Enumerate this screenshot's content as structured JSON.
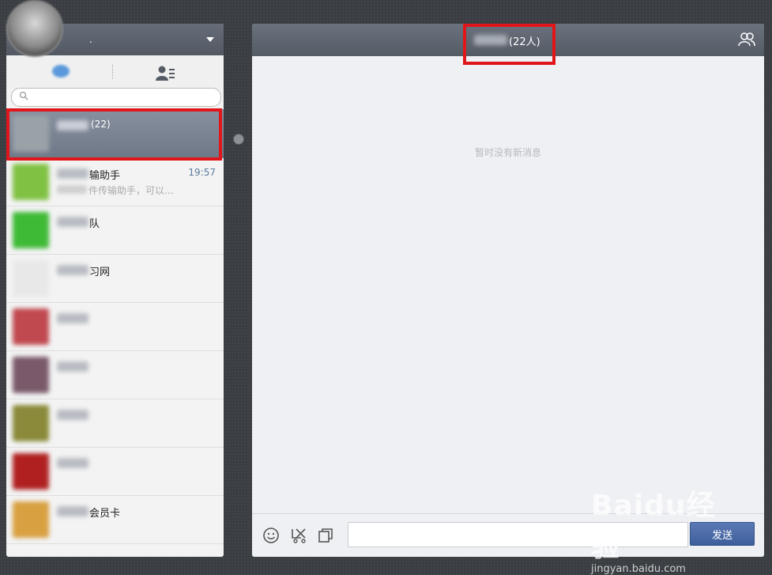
{
  "left_panel": {
    "user_name_tail": ".",
    "search_placeholder": "",
    "chats": [
      {
        "name_tail": "(22)",
        "preview_tail": "",
        "time": "",
        "avatar_color": "#9aa2a8",
        "selected": true
      },
      {
        "name_tail": "输助手",
        "preview_tail": "件传输助手，可以...",
        "time": "19:57",
        "avatar_color": "#7fc142",
        "selected": false
      },
      {
        "name_tail": "队",
        "preview_tail": "",
        "time": "",
        "avatar_color": "#3fba36",
        "selected": false
      },
      {
        "name_tail": "习网",
        "preview_tail": "",
        "time": "",
        "avatar_color": "#e8e8e8",
        "selected": false
      },
      {
        "name_tail": "",
        "preview_tail": "",
        "time": "",
        "avatar_color": "#c0484f",
        "selected": false
      },
      {
        "name_tail": "",
        "preview_tail": "",
        "time": "",
        "avatar_color": "#7a5a6a",
        "selected": false
      },
      {
        "name_tail": "",
        "preview_tail": "",
        "time": "",
        "avatar_color": "#8a8a3a",
        "selected": false
      },
      {
        "name_tail": "",
        "preview_tail": "",
        "time": "",
        "avatar_color": "#b02020",
        "selected": false
      },
      {
        "name_tail": "会员卡",
        "preview_tail": "",
        "time": "",
        "avatar_color": "#d8a040",
        "selected": false
      }
    ]
  },
  "chat": {
    "title_count": "(22人)",
    "empty_message": "暂时没有新消息",
    "input_value": "",
    "send_label": "发送"
  },
  "watermark": {
    "logo": "Baidu经验",
    "url": "jingyan.baidu.com"
  },
  "colors": {
    "header": "#5e656f",
    "highlight": "#e0161b",
    "send_button": "#4a6aa8"
  }
}
